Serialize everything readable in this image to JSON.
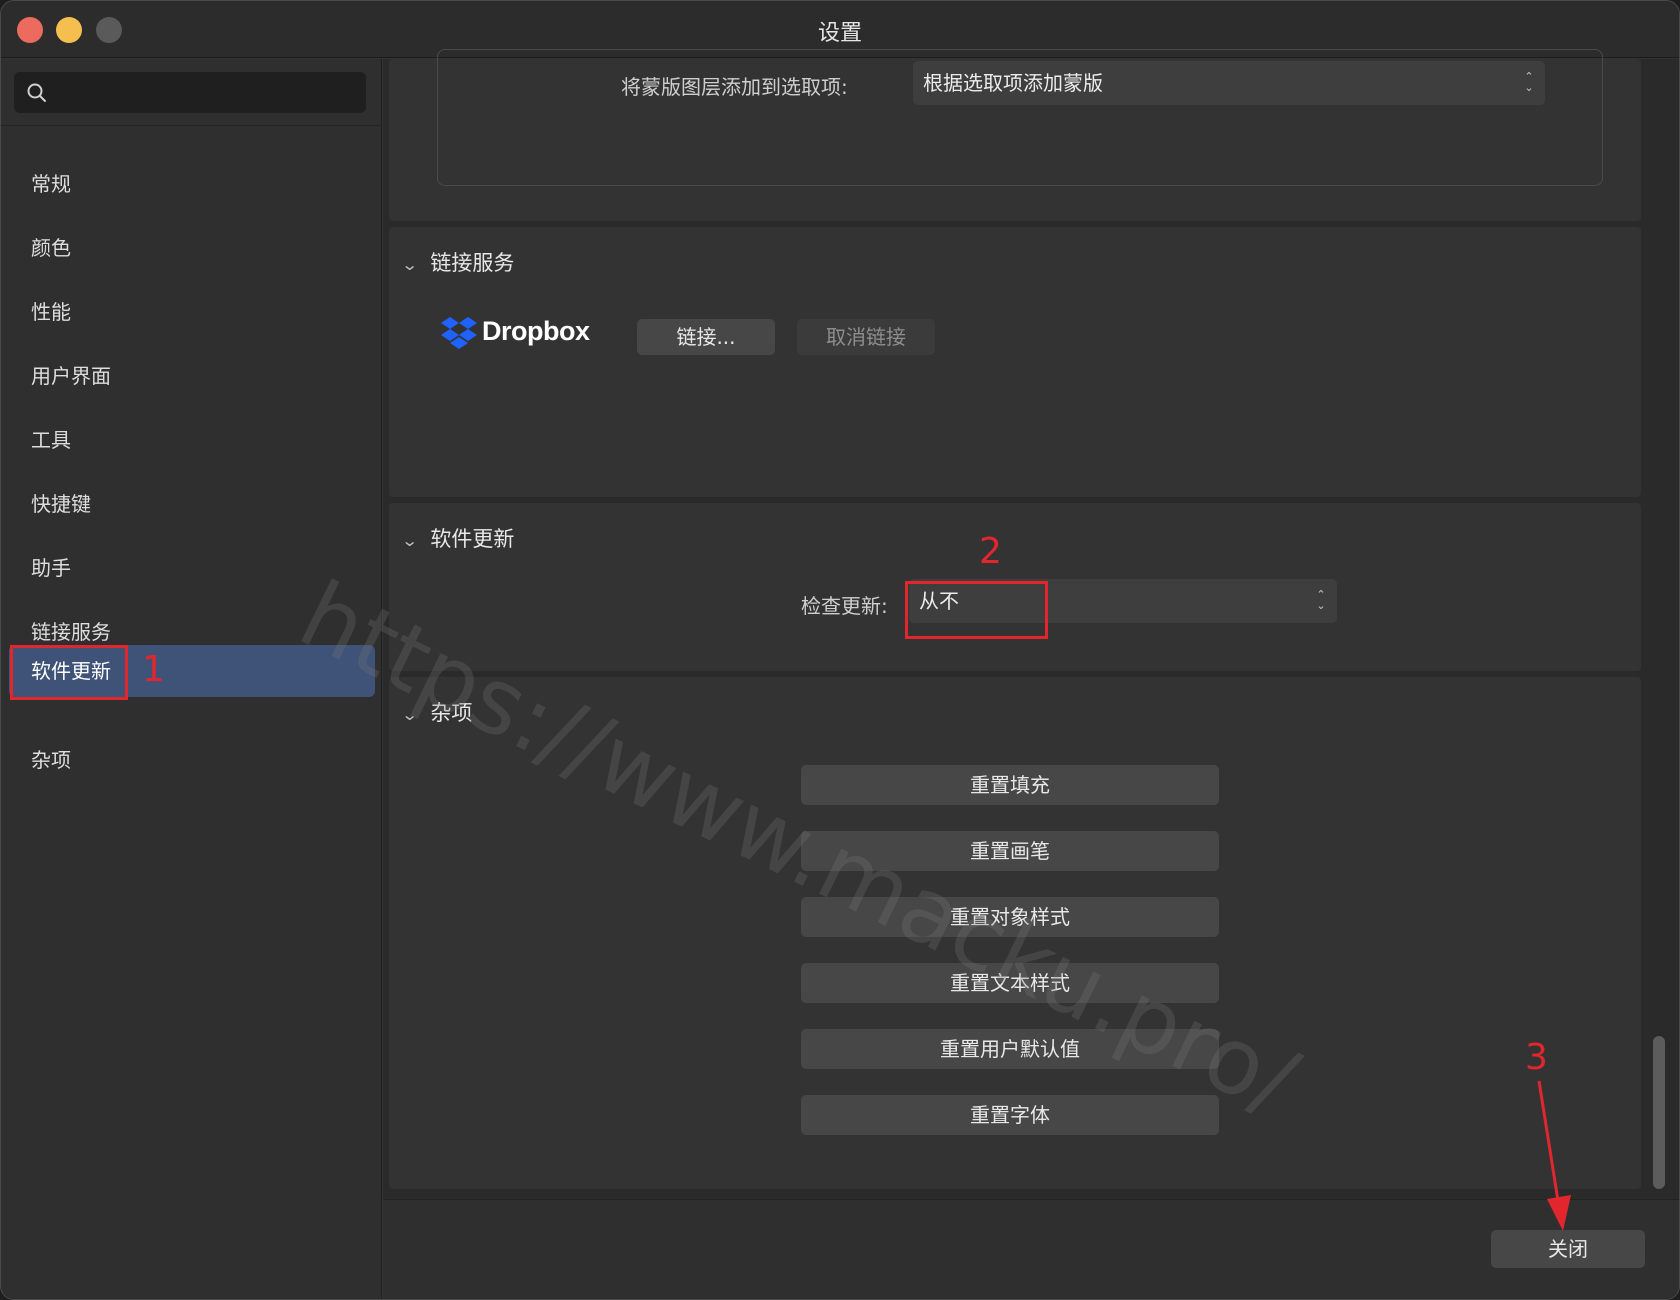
{
  "window": {
    "title": "设置"
  },
  "sidebar": {
    "search": {
      "placeholder": ""
    },
    "items": [
      {
        "label": "常规"
      },
      {
        "label": "颜色"
      },
      {
        "label": "性能"
      },
      {
        "label": "用户界面"
      },
      {
        "label": "工具"
      },
      {
        "label": "快捷键"
      },
      {
        "label": "助手"
      },
      {
        "label": "链接服务"
      },
      {
        "label": "软件更新",
        "active": true
      },
      {
        "label": "杂项"
      }
    ]
  },
  "main": {
    "mask_section": {
      "label": "将蒙版图层添加到选取项:",
      "value": "根据选取项添加蒙版"
    },
    "link_service": {
      "title": "链接服务",
      "provider": "Dropbox",
      "link_button": "链接...",
      "unlink_button": "取消链接"
    },
    "software_update": {
      "title": "软件更新",
      "check_label": "检查更新:",
      "check_value": "从不"
    },
    "misc": {
      "title": "杂项",
      "buttons": [
        {
          "label": "重置填充"
        },
        {
          "label": "重置画笔"
        },
        {
          "label": "重置对象样式"
        },
        {
          "label": "重置文本样式"
        },
        {
          "label": "重置用户默认值"
        },
        {
          "label": "重置字体"
        }
      ]
    }
  },
  "footer": {
    "close_button": "关闭"
  },
  "annotations": [
    "1",
    "2",
    "3"
  ],
  "watermark": "https://www.macku.pro/",
  "colors": {
    "accent_selected": "#3f5378",
    "annotation_red": "#e2262e",
    "dropbox_blue": "#1e62ff"
  }
}
